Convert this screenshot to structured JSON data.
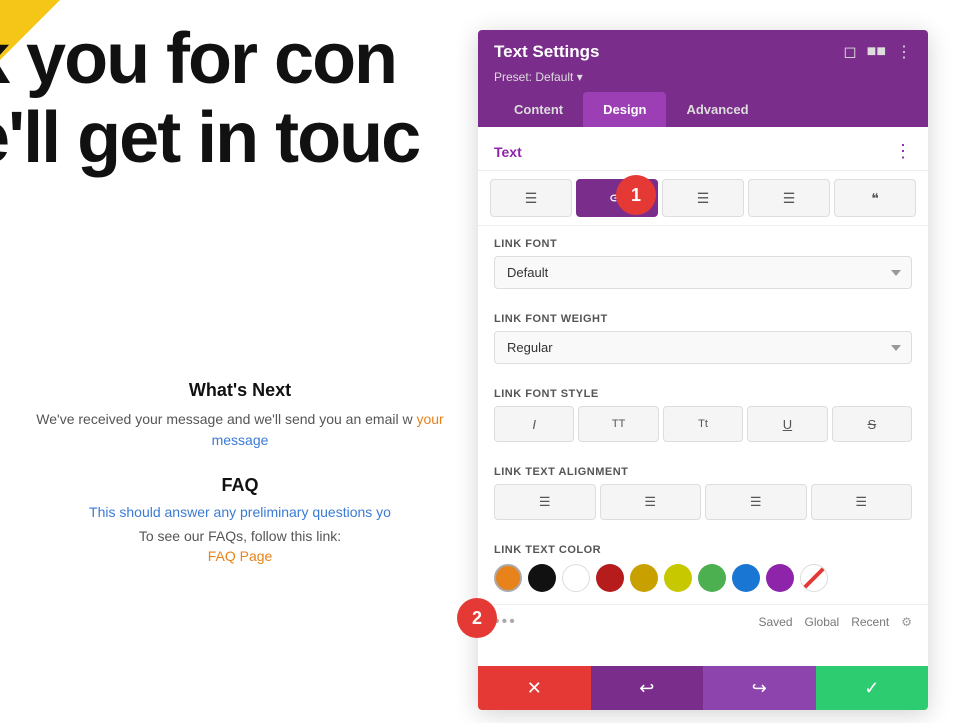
{
  "background": {
    "heading_line1": "k you for con",
    "heading_line2": "e'll get in touc",
    "whats_next_title": "What's Next",
    "whats_next_desc": "We've received your message and we'll send you an email w",
    "faq_title": "FAQ",
    "faq_desc": "This should answer any preliminary questions yo",
    "faq_link_line": "To see our FAQs, follow this link:",
    "faq_page": "FAQ Page"
  },
  "panel": {
    "title": "Text Settings",
    "preset_label": "Preset: Default",
    "tabs": [
      {
        "label": "Content",
        "active": false
      },
      {
        "label": "Design",
        "active": true
      },
      {
        "label": "Advanced",
        "active": false
      }
    ],
    "section_title": "Text",
    "icon_tabs": [
      {
        "icon": "≡",
        "active": false
      },
      {
        "icon": "🔗",
        "active": true
      },
      {
        "icon": "≡",
        "active": false
      },
      {
        "icon": "≡",
        "active": false
      },
      {
        "icon": "❝",
        "active": false
      }
    ],
    "link_font_label": "Link Font",
    "link_font_value": "Default",
    "link_font_weight_label": "Link Font Weight",
    "link_font_weight_value": "Regular",
    "link_font_style_label": "Link Font Style",
    "style_buttons": [
      "I",
      "TT",
      "Tt",
      "U",
      "S"
    ],
    "link_text_alignment_label": "Link Text Alignment",
    "align_buttons": [
      "≡",
      "≡",
      "≡",
      "≡"
    ],
    "link_text_color_label": "Link Text Color",
    "colors": [
      {
        "hex": "#e8821a",
        "label": "orange",
        "active": true
      },
      {
        "hex": "#111111",
        "label": "black"
      },
      {
        "hex": "#ffffff",
        "label": "white"
      },
      {
        "hex": "#b71c1c",
        "label": "dark-red"
      },
      {
        "hex": "#c8a000",
        "label": "gold"
      },
      {
        "hex": "#c8c800",
        "label": "yellow"
      },
      {
        "hex": "#4caf50",
        "label": "green"
      },
      {
        "hex": "#1976d2",
        "label": "blue"
      },
      {
        "hex": "#8e24aa",
        "label": "purple"
      },
      {
        "hex": "transparent",
        "label": "transparent"
      }
    ],
    "color_footer": {
      "dots": "•••",
      "saved": "Saved",
      "global": "Global",
      "recent": "Recent"
    },
    "footer_buttons": [
      {
        "icon": "✕",
        "type": "cancel"
      },
      {
        "icon": "↩",
        "type": "undo"
      },
      {
        "icon": "↪",
        "type": "redo"
      },
      {
        "icon": "✓",
        "type": "save"
      }
    ]
  },
  "badges": [
    {
      "number": "1",
      "id": "badge1"
    },
    {
      "number": "2",
      "id": "badge2"
    }
  ]
}
